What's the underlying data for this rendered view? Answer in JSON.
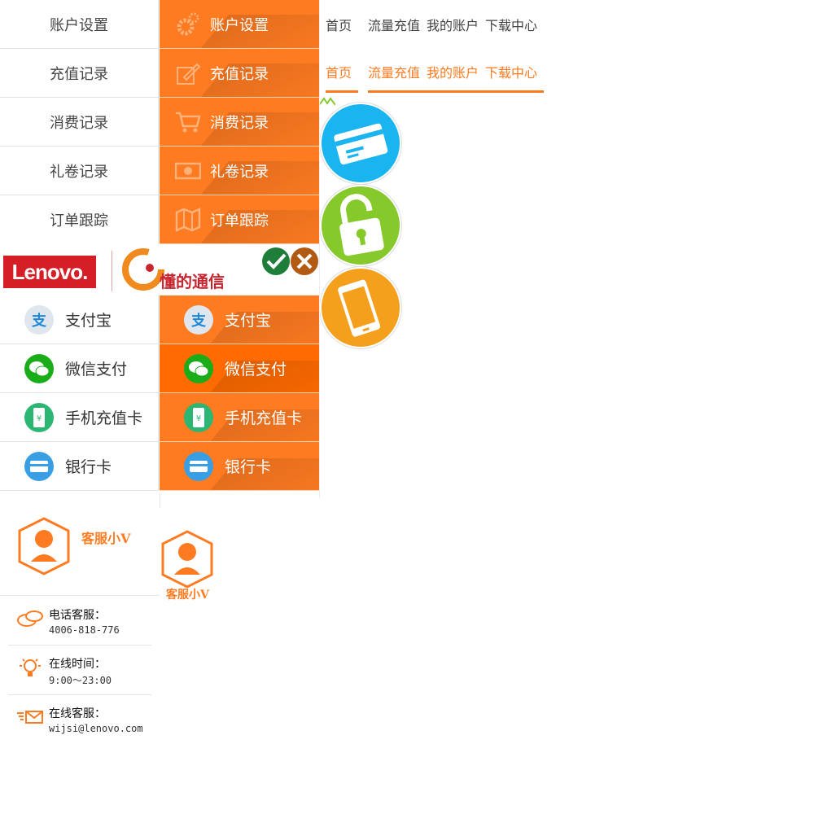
{
  "menu": {
    "items": [
      {
        "label": "账户设置",
        "icon": "gear-icon"
      },
      {
        "label": "充值记录",
        "icon": "pencil-icon"
      },
      {
        "label": "消费记录",
        "icon": "cart-icon"
      },
      {
        "label": "礼卷记录",
        "icon": "coupon-icon"
      },
      {
        "label": "订单跟踪",
        "icon": "map-icon"
      }
    ]
  },
  "nav": {
    "items": [
      "首页",
      "流量充值",
      "我的账户",
      "下载中心"
    ]
  },
  "logos": {
    "lenovo": "Lenovo.",
    "tong": "懂的通信"
  },
  "payments": {
    "items": [
      {
        "label": "支付宝",
        "icon": "alipay-icon",
        "color": "#1e88d8"
      },
      {
        "label": "微信支付",
        "icon": "wechat-icon",
        "color": "#1aad19"
      },
      {
        "label": "手机充值卡",
        "icon": "phone-card-icon",
        "color": "#2bb673"
      },
      {
        "label": "银行卡",
        "icon": "bank-card-icon",
        "color": "#3a9ee4"
      }
    ]
  },
  "service": {
    "name": "客服小V",
    "name_small": "客服小V",
    "phone_label": "电话客服：",
    "phone_value": "4006-818-776",
    "hours_label": "在线时间：",
    "hours_value": "9:00～23:00",
    "mail_label": "在线客服：",
    "mail_value": "wijsi@lenovo.com"
  },
  "colors": {
    "accent": "#ff7b21",
    "circle_card": "#1ab5f0",
    "circle_lock": "#86c92b",
    "circle_phone": "#f5a01c"
  }
}
